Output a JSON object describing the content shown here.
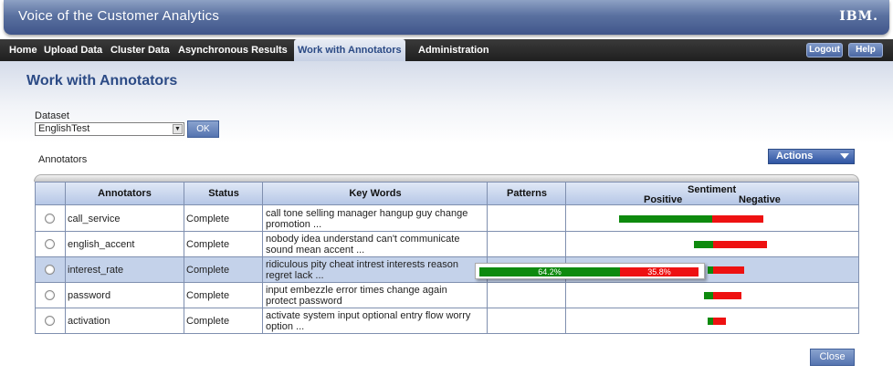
{
  "app": {
    "title": "Voice of the Customer Analytics",
    "logo_text": "IBM."
  },
  "nav": {
    "items": [
      {
        "label": "Home"
      },
      {
        "label": "Upload Data"
      },
      {
        "label": "Cluster Data"
      },
      {
        "label": "Asynchronous Results"
      },
      {
        "label": "Work with Annotators",
        "active": true
      },
      {
        "label": "Administration"
      }
    ],
    "logout_label": "Logout",
    "help_label": "Help"
  },
  "page": {
    "title": "Work with Annotators"
  },
  "dataset": {
    "label": "Dataset",
    "selected": "EnglishTest",
    "ok_label": "OK"
  },
  "annotators_section": {
    "label": "Annotators",
    "actions_label": "Actions"
  },
  "table": {
    "headers": {
      "annotators": "Annotators",
      "status": "Status",
      "keywords": "Key Words",
      "patterns": "Patterns",
      "sentiment": "Sentiment",
      "positive": "Positive",
      "negative": "Negative"
    },
    "rows": [
      {
        "name": "call_service",
        "status": "Complete",
        "keywords_line1": "call tone selling manager hangup guy change",
        "keywords_line2": "promotion ...",
        "patterns": "",
        "selected": false
      },
      {
        "name": "english_accent",
        "status": "Complete",
        "keywords_line1": "nobody idea understand can't communicate",
        "keywords_line2": "sound mean accent ...",
        "patterns": "",
        "selected": false
      },
      {
        "name": "interest_rate",
        "status": "Complete",
        "keywords_line1": "ridiculous pity cheat intrest interests reason",
        "keywords_line2": "regret lack ...",
        "patterns": "",
        "selected": true
      },
      {
        "name": "password",
        "status": "Complete",
        "keywords_line1": "input embezzle error times change again",
        "keywords_line2": "protect password",
        "patterns": "",
        "selected": false
      },
      {
        "name": "activation",
        "status": "Complete",
        "keywords_line1": "activate system input optional entry flow worry",
        "keywords_line2": "option ...",
        "patterns": "",
        "selected": false
      }
    ]
  },
  "tooltip": {
    "positive_label": "64.2%",
    "negative_label": "35.8%"
  },
  "close_label": "Close",
  "colors": {
    "positive": "#0e8a0e",
    "negative": "#ee1111",
    "accent": "#2b4a85"
  }
}
